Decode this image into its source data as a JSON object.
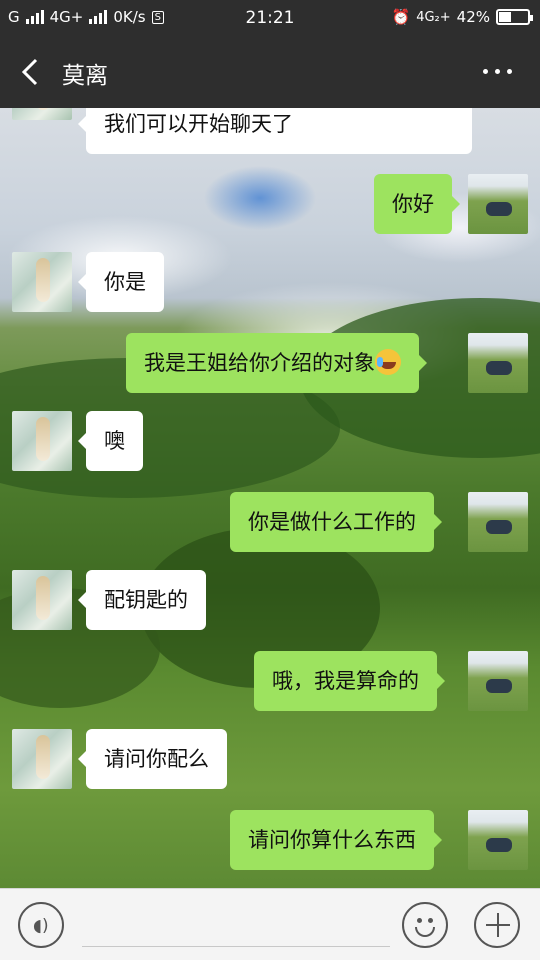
{
  "status_bar": {
    "carrier_left": "G",
    "network_left": "4G+",
    "speed": "0K/s",
    "time": "21:21",
    "network_right": "4G₂+",
    "battery": "42%",
    "battery_level": 0.42
  },
  "header": {
    "title": "莫离",
    "back_icon": "chevron-left-icon",
    "more_icon": "more-dots-icon"
  },
  "messages": [
    {
      "side": "left",
      "text": "我们可以开始聊天了"
    },
    {
      "side": "right",
      "text": "你好"
    },
    {
      "side": "left",
      "text": "你是"
    },
    {
      "side": "right",
      "text": "我是王姐给你介绍的对象",
      "emoji": "crying-laughing-emoji"
    },
    {
      "side": "left",
      "text": "噢"
    },
    {
      "side": "right",
      "text": "你是做什么工作的"
    },
    {
      "side": "left",
      "text": "配钥匙的"
    },
    {
      "side": "right",
      "text": "哦，我是算命的"
    },
    {
      "side": "left",
      "text": "请问你配么"
    },
    {
      "side": "right",
      "text": "请问你算什么东西"
    }
  ],
  "input_bar": {
    "voice_icon": "voice-icon",
    "emoji_icon": "emoji-icon",
    "plus_icon": "plus-icon"
  },
  "colors": {
    "header_bg": "#2e2e2e",
    "bubble_green": "#9de35f",
    "bubble_white": "#ffffff"
  }
}
